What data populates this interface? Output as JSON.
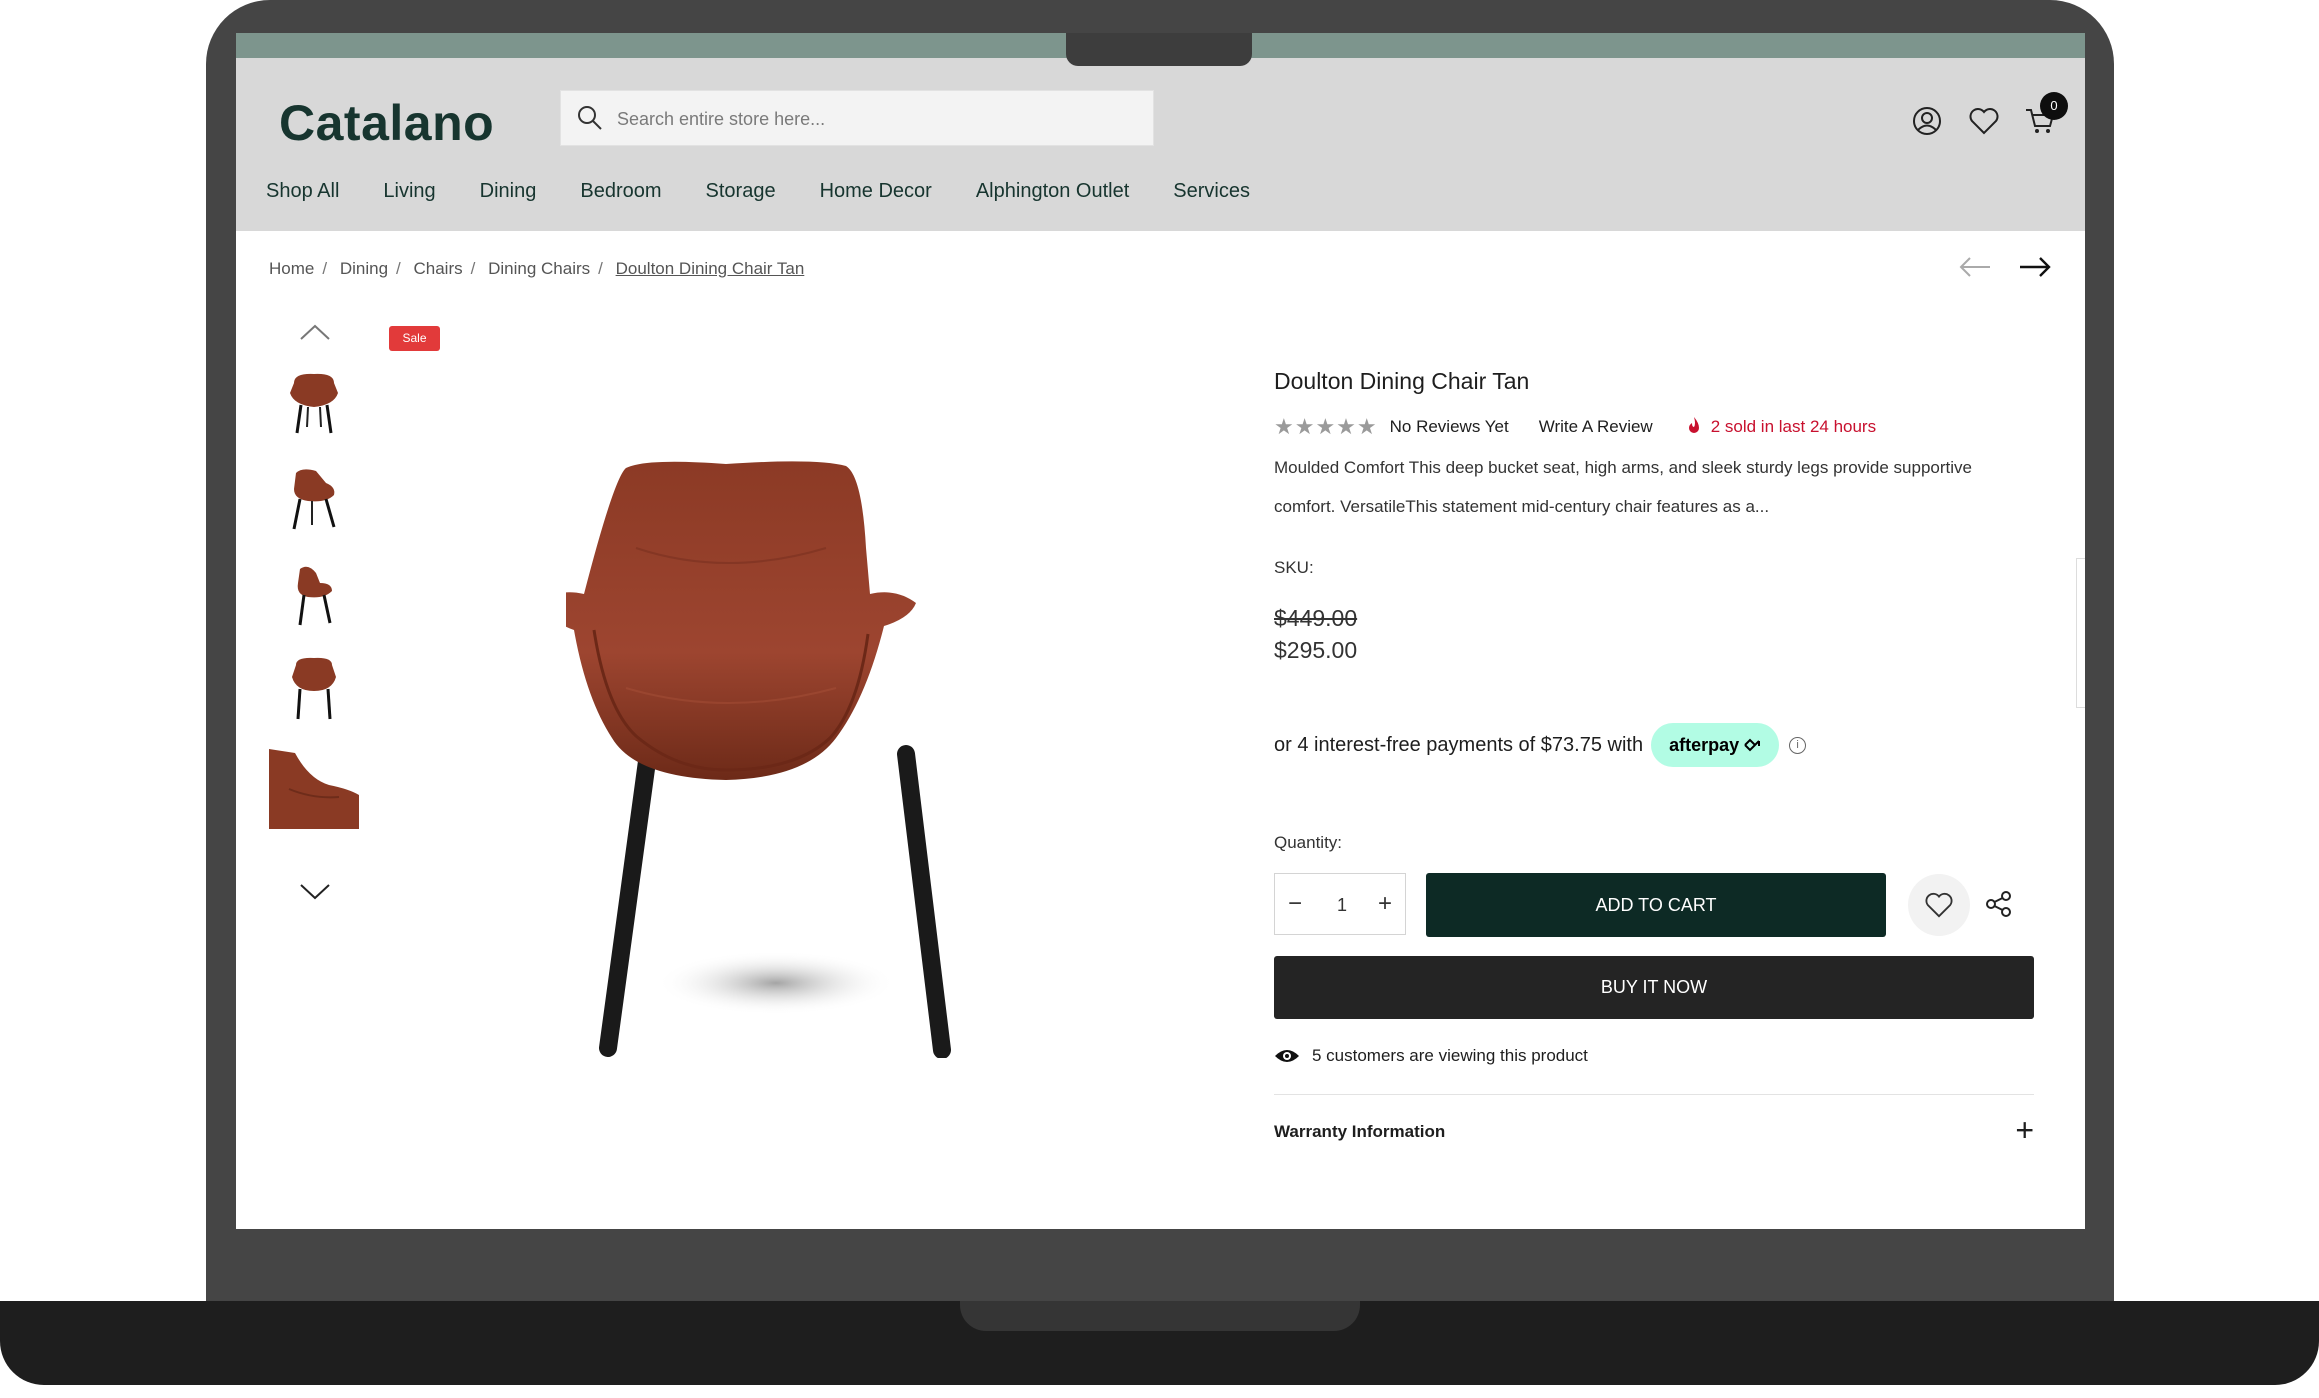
{
  "header": {
    "logo": "Catalano",
    "search_placeholder": "Search entire store here...",
    "cart_count": "0"
  },
  "nav": {
    "items": [
      "Shop All",
      "Living",
      "Dining",
      "Bedroom",
      "Storage",
      "Home Decor",
      "Alphington Outlet",
      "Services"
    ]
  },
  "breadcrumb": {
    "items": [
      "Home",
      "Dining",
      "Chairs",
      "Dining Chairs"
    ],
    "current": "Doulton Dining Chair Tan",
    "separator": "/"
  },
  "gallery": {
    "sale_badge": "Sale",
    "thumbnail_count": 5
  },
  "product": {
    "title": "Doulton Dining Chair Tan",
    "stars": "★★★★★",
    "reviews": "No Reviews Yet",
    "write_review": "Write A Review",
    "sold": "2 sold in last 24 hours",
    "description": "Moulded Comfort This deep bucket seat, high arms, and sleek sturdy legs provide supportive comfort. VersatileThis statement mid-century chair features as a...",
    "sku_label": "SKU:",
    "old_price": "$449.00",
    "new_price": "$295.00",
    "afterpay_text": "or 4 interest-free payments of $73.75 with",
    "afterpay_brand": "afterpay",
    "quantity_label": "Quantity:",
    "quantity_value": "1",
    "add_to_cart": "ADD TO CART",
    "buy_now": "BUY IT NOW",
    "viewing": "5 customers are viewing this product",
    "warranty": "Warranty Information"
  },
  "colors": {
    "brand": "#17352f",
    "add_to_cart_bg": "#0d2a25",
    "buy_now_bg": "#242424",
    "sale": "#e23a3a",
    "sold_text": "#c8102e",
    "afterpay": "#b2fce4",
    "header_bg": "#d8d8d8",
    "top_strip": "#7d958d"
  }
}
